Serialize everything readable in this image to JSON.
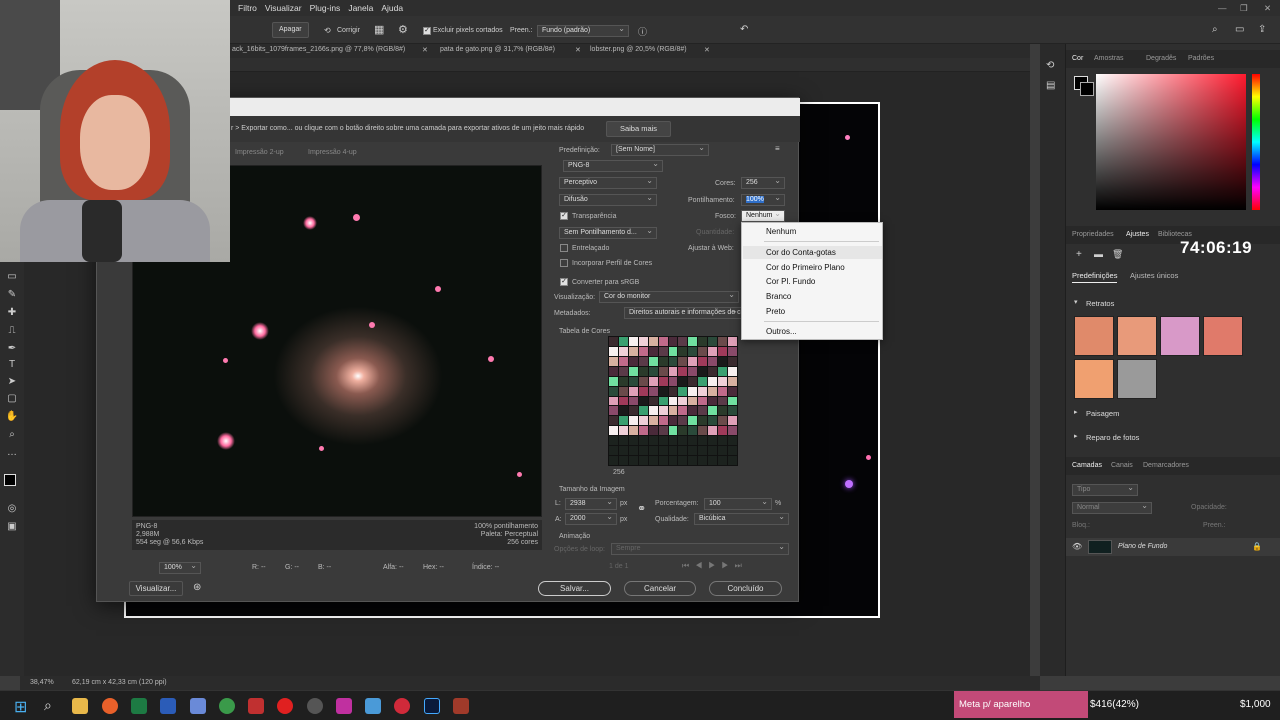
{
  "menu": [
    "Filtro",
    "Visualizar",
    "Plug-ins",
    "Janela",
    "Ajuda"
  ],
  "options": {
    "apagar": "Apagar",
    "corrigir": "Corrigir",
    "excluir": "Excluir pixels cortados",
    "preen_label": "Preen.:",
    "preen_value": "Fundo (padrão)"
  },
  "doc_tabs": [
    "ack_16bits_1079frames_2166s.png @ 77,8% (RGB/8#)",
    "pata de gato.png @ 31,7% (RGB/8#)",
    "lobster.png @ 20,5% (RGB/8#)"
  ],
  "dialog": {
    "hint": "r > Exportar como... ou clique com o botão direito sobre uma camada para exportar ativos de um jeito mais rápido",
    "saiba_mais": "Saiba mais",
    "preview_tabs": [
      "Impressão 2-up",
      "Impressão 4-up"
    ],
    "predefinicao_label": "Predefinição:",
    "predefinicao_value": "[Sem Nome]",
    "format": "PNG-8",
    "reduction": "Perceptivo",
    "dither": "Difusão",
    "transparency_label": "Transparência",
    "trans_dither": "Sem Pontilhamento d...",
    "interlaced": "Entrelaçado",
    "embed_profile": "Incorporar Perfil de Cores",
    "cores_label": "Cores:",
    "cores_value": "256",
    "pont_label": "Pontilhamento:",
    "pont_value": "100%",
    "fosco_label": "Fosco:",
    "fosco_value": "Nenhum",
    "quantity_label": "Quantidade:",
    "ajustar_label": "Ajustar à Web:",
    "convert_srgb": "Converter para sRGB",
    "visualizacao_label": "Visualização:",
    "visualizacao_value": "Cor do monitor",
    "metadados_label": "Metadados:",
    "metadados_value": "Direitos autorais e informações de contato",
    "color_table": "Tabela de Cores",
    "color_count": "256",
    "image_size": "Tamanho da Imagem",
    "l_label": "L:",
    "l_value": "2938",
    "a_label": "A:",
    "a_value": "2000",
    "px": "px",
    "percent_label": "Porcentagem:",
    "percent_value": "100",
    "percent_unit": "%",
    "quality_label": "Qualidade:",
    "quality_value": "Bicúbica",
    "animation": "Animação",
    "loop_label": "Opções de loop:",
    "loop_value": "Sempre",
    "frame": "1 de 1",
    "info_left": [
      "PNG-8",
      "2,988M",
      "554 seg @ 56,6 Kbps"
    ],
    "info_right": [
      "100% pontilhamento",
      "Paleta: Perceptual",
      "256 cores"
    ],
    "zoom": "100%",
    "readouts": [
      "R: --",
      "G: --",
      "B: --",
      "Alfa: --",
      "Hex: --",
      "Índice: --"
    ],
    "visualizar_btn": "Visualizar...",
    "salvar_btn": "Salvar...",
    "cancelar_btn": "Cancelar",
    "concluido_btn": "Concluído"
  },
  "dropdown": [
    "Nenhum",
    "Cor do Conta-gotas",
    "Cor do Primeiro Plano",
    "Cor Pl. Fundo",
    "Branco",
    "Preto",
    "Outros..."
  ],
  "panel": {
    "color_tabs": [
      "Cor",
      "Amostras",
      "Degradês",
      "Padrões"
    ],
    "adj_tabs": [
      "Propriedades",
      "Ajustes",
      "Bibliotecas"
    ],
    "sub_tabs": [
      "Predefinições",
      "Ajustes únicos"
    ],
    "retratos": "Retratos",
    "paisagem": "Paisagem",
    "reparo": "Reparo de fotos",
    "layer_tabs": [
      "Camadas",
      "Canais",
      "Demarcadores"
    ],
    "search_placeholder": "Tipo",
    "blend": "Normal",
    "opacity_label": "Opacidade:",
    "bloq_label": "Bloq.:",
    "fill_label": "Preen.:",
    "layer_name": "Plano de Fundo"
  },
  "timer": "74:06:19",
  "status_zoom": "38,47%",
  "status_info": "62,19 cm x 42,33 cm (120 ppi)",
  "taskbar": {
    "meta": "Meta p/ aparelho",
    "progress": "$416(42%)",
    "goal": "$1,000"
  }
}
